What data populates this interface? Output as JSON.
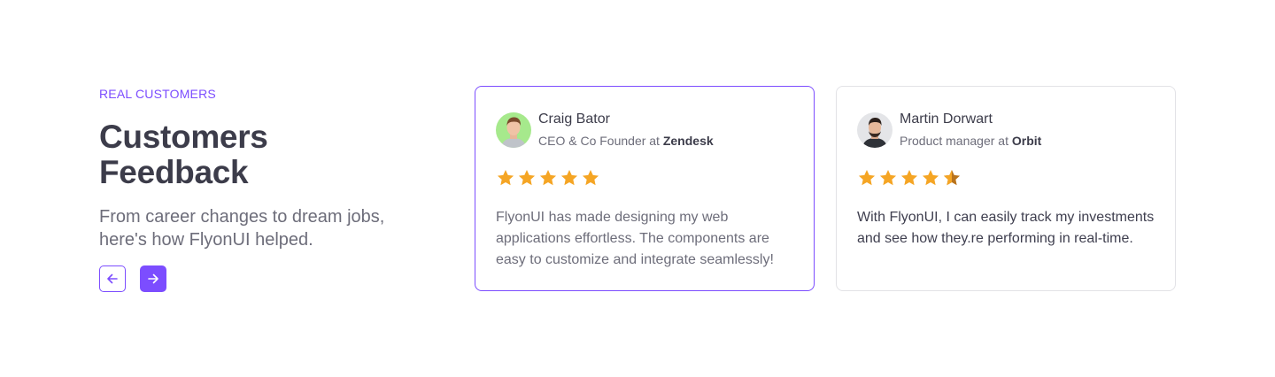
{
  "intro": {
    "eyebrow": "REAL CUSTOMERS",
    "title_line1": "Customers",
    "title_line2": "Feedback",
    "subtitle": "From career changes to dream jobs, here's how FlyonUI helped."
  },
  "colors": {
    "accent": "#7c4dff",
    "star": "#f5a524",
    "star_half": "#b9731c"
  },
  "nav": {
    "prev_icon": "arrow-left-icon",
    "next_icon": "arrow-right-icon"
  },
  "testimonials": [
    {
      "name": "Craig Bator",
      "role_prefix": "CEO & Co Founder at ",
      "company": "Zendesk",
      "rating": 5,
      "quote": "FlyonUI has made designing my web applications effortless. The components are easy to customize and integrate seamlessly!",
      "active": true
    },
    {
      "name": "Martin Dorwart",
      "role_prefix": "Product manager at ",
      "company": "Orbit",
      "rating": 4.5,
      "quote": "With FlyonUI, I can easily track my investments and see how they.re performing in real-time.",
      "active": false
    }
  ]
}
